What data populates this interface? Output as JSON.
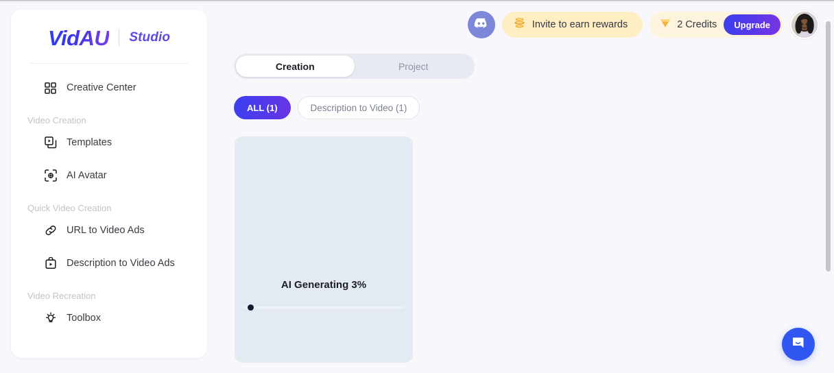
{
  "brand": {
    "logo": "VidAU",
    "sub": "Studio"
  },
  "sidebar": {
    "top_items": [
      {
        "label": "Creative Center",
        "icon": "grid-icon"
      }
    ],
    "groups": [
      {
        "title": "Video Creation",
        "items": [
          {
            "label": "Templates",
            "icon": "templates-icon"
          },
          {
            "label": "AI Avatar",
            "icon": "ai-avatar-icon"
          }
        ]
      },
      {
        "title": "Quick Video Creation",
        "items": [
          {
            "label": "URL to Video Ads",
            "icon": "link-icon"
          },
          {
            "label": "Description to Video Ads",
            "icon": "description-video-icon"
          }
        ]
      },
      {
        "title": "Video Recreation",
        "items": [
          {
            "label": "Toolbox",
            "icon": "lightbulb-icon"
          }
        ]
      }
    ]
  },
  "header": {
    "discord_icon": "discord-icon",
    "invite": {
      "label": "Invite to earn rewards",
      "icon": "coins-icon"
    },
    "credits": {
      "label": "2 Credits",
      "icon": "gem-icon",
      "upgrade_label": "Upgrade"
    },
    "avatar": "user-avatar"
  },
  "main": {
    "tabs": [
      {
        "label": "Creation",
        "active": true
      },
      {
        "label": "Project",
        "active": false
      }
    ],
    "filter_chips": [
      {
        "label": "ALL (1)",
        "active": true
      },
      {
        "label": "Description to Video (1)",
        "active": false
      }
    ],
    "card": {
      "status": "AI Generating 3%",
      "progress_percent": 3
    }
  },
  "widgets": {
    "intercom_icon": "chat-bubble-icon"
  },
  "colors": {
    "page_bg": "#f7f7fc",
    "sidebar_bg": "#ffffff",
    "accent_blue": "#3a3ff0",
    "accent_purple": "#7a34e2",
    "credits_bg": "#fdf4de",
    "invite_bg": "#fdeec3",
    "card_bg": "#e4eaf1",
    "intercom_blue": "#2f56f0"
  }
}
